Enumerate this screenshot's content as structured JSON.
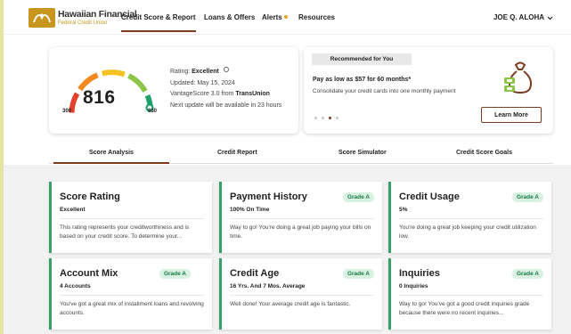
{
  "header": {
    "logo_name": "Hawaiian Financial",
    "logo_sub": "Federal Credit Union",
    "nav": [
      {
        "label": "Credit Score & Report",
        "active": true
      },
      {
        "label": "Loans & Offers"
      },
      {
        "label": "Alerts"
      },
      {
        "label": "Resources"
      }
    ],
    "user_name": "JOE Q. ALOHA",
    "alert_dot_color": "#f2a41c"
  },
  "score": {
    "value": "816",
    "min": "300",
    "max": "850",
    "rating_label": "Rating:",
    "rating_value": "Excellent",
    "updated": "Updated: May 15, 2024",
    "model_prefix": "VantageScore 3.0 from",
    "bureau": "TransUnion",
    "next_update": "Next update will be available in 23 hours",
    "gauge_colors": [
      "#e2412b",
      "#f28a1f",
      "#f4c321",
      "#8cc447",
      "#1ea06a"
    ]
  },
  "promo": {
    "tag": "Recommended for You",
    "headline": "Pay as low as $57 for 60 months*",
    "body": "Consolidate your credit cards into one monthly payment",
    "button": "Learn More",
    "slides": 4,
    "active_slide": 3
  },
  "tabs": [
    {
      "label": "Score Analysis",
      "active": true
    },
    {
      "label": "Credit Report"
    },
    {
      "label": "Score Simulator"
    },
    {
      "label": "Credit Score Goals"
    }
  ],
  "cards": [
    {
      "title": "Score Rating",
      "sub": "Excellent",
      "grade": "",
      "desc": "This rating represents your creditworthiness and is based on your credit score. To determine your..."
    },
    {
      "title": "Payment History",
      "sub": "100% On Time",
      "grade": "Grade A",
      "desc": "Way to go! You're doing a great job paying your bills on time."
    },
    {
      "title": "Credit Usage",
      "sub": "5%",
      "grade": "Grade A",
      "desc": "You're doing a great job keeping your credit utilization low."
    },
    {
      "title": "Account Mix",
      "sub": "4 Accounts",
      "grade": "Grade A",
      "desc": "You've got a great mix of installment loans and revolving accounts."
    },
    {
      "title": "Credit Age",
      "sub": "16 Yrs. And 7 Mos. Average",
      "grade": "Grade A",
      "desc": "Well done! Your average credit age is fantastic."
    },
    {
      "title": "Inquiries",
      "sub": "0 Inquiries",
      "grade": "Grade A",
      "desc": "Way to go! You've got a good credit inquiries grade because there were no recent inquiries..."
    }
  ]
}
